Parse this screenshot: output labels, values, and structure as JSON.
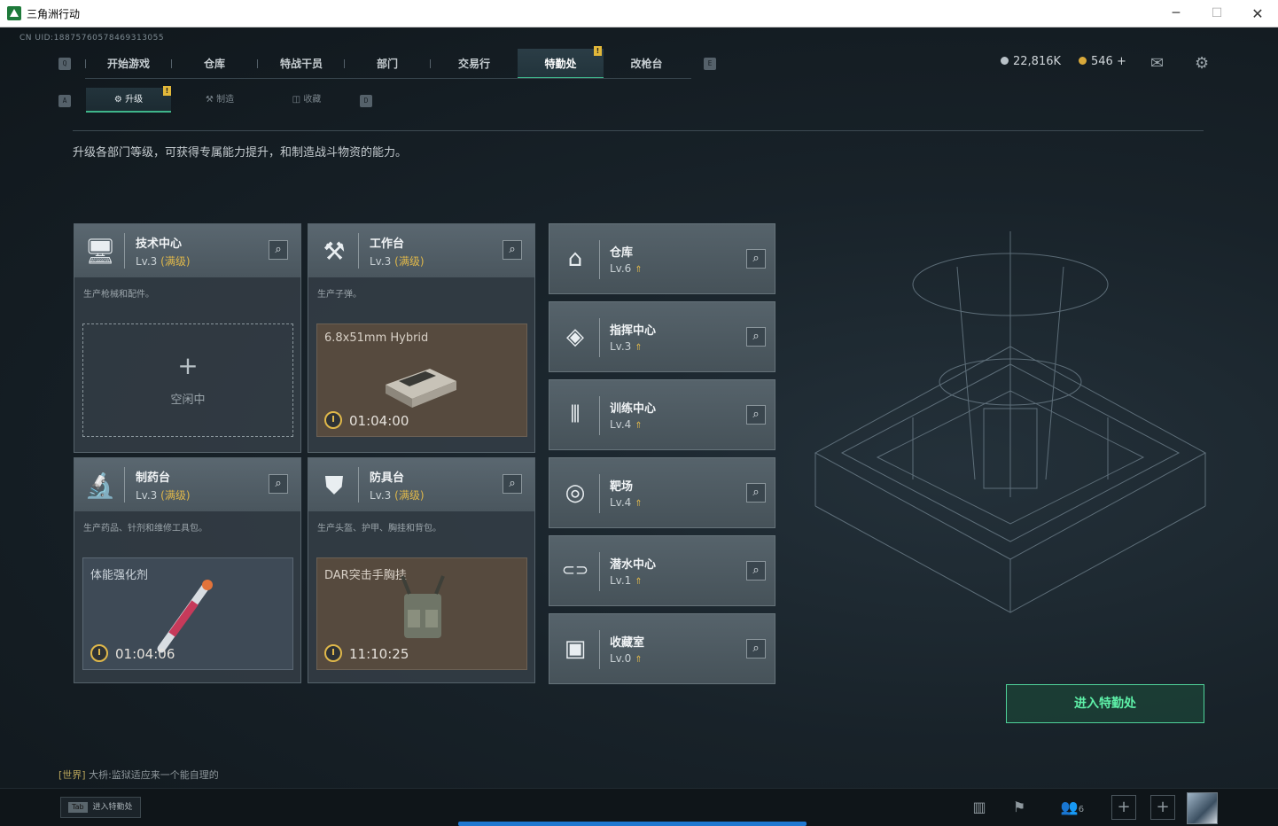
{
  "window": {
    "title": "三角洲行动",
    "min": "─",
    "max": "☐",
    "close": "✕"
  },
  "uid": "CN UID:18875760578469313055",
  "nav": {
    "key_left": "Q",
    "key_right": "E",
    "tabs": [
      "开始游戏",
      "仓库",
      "特战干员",
      "部门",
      "交易行",
      "特勤处",
      "改枪台"
    ],
    "active": "特勤处",
    "badge": "!"
  },
  "currency": {
    "silver": "22,816K",
    "gold": "546",
    "gold_add": "+",
    "silver_color": "#b9c2c8",
    "gold_color": "#d9a93a"
  },
  "subnav": {
    "key_left": "A",
    "key_right": "D",
    "tabs": [
      "升级",
      "制造",
      "收藏"
    ],
    "active": "升级",
    "badge": "!"
  },
  "description": "升级各部门等级，可获得专属能力提升，和制造战斗物资的能力。",
  "workshops": [
    {
      "name": "技术中心",
      "level": "Lv.3",
      "max": "(满级)",
      "desc": "生产枪械和配件。",
      "slot": {
        "state": "idle",
        "plus": "+",
        "label": "空闲中"
      },
      "icon": "monitor-icon"
    },
    {
      "name": "工作台",
      "level": "Lv.3",
      "max": "(满级)",
      "desc": "生产子弹。",
      "slot": {
        "state": "busy",
        "item": "6.8x51mm Hybrid",
        "timer": "01:04:00"
      },
      "icon": "tools-icon"
    },
    {
      "name": "制药台",
      "level": "Lv.3",
      "max": "(满级)",
      "desc": "生产药品、针剂和维修工具包。",
      "slot": {
        "state": "busy",
        "item": "体能强化剂",
        "timer": "01:04:06"
      },
      "icon": "microscope-icon"
    },
    {
      "name": "防具台",
      "level": "Lv.3",
      "max": "(满级)",
      "desc": "生产头盔、护甲、胸挂和背包。",
      "slot": {
        "state": "busy",
        "item": "DAR突击手胸挂",
        "timer": "11:10:25"
      },
      "icon": "armor-icon"
    }
  ],
  "facilities": [
    {
      "name": "仓库",
      "level": "Lv.6",
      "icon": "warehouse-icon",
      "glyph": "⌂"
    },
    {
      "name": "指挥中心",
      "level": "Lv.3",
      "icon": "command-icon",
      "glyph": "◈"
    },
    {
      "name": "训练中心",
      "level": "Lv.4",
      "icon": "dumbbell-icon",
      "glyph": "⫴"
    },
    {
      "name": "靶场",
      "level": "Lv.4",
      "icon": "target-icon",
      "glyph": "◎"
    },
    {
      "name": "潜水中心",
      "level": "Lv.1",
      "icon": "goggles-icon",
      "glyph": "⊂⊃"
    },
    {
      "name": "收藏室",
      "level": "Lv.0",
      "icon": "collection-icon",
      "glyph": "▣"
    }
  ],
  "enter_button": "进入特勤处",
  "chat": {
    "channel": "[世界]",
    "user": "大枡:",
    "message": "监狱适应来一个能自理的"
  },
  "bottom": {
    "tab_key": "Tab",
    "tab_label": "进入特勤处",
    "friends": "6"
  }
}
